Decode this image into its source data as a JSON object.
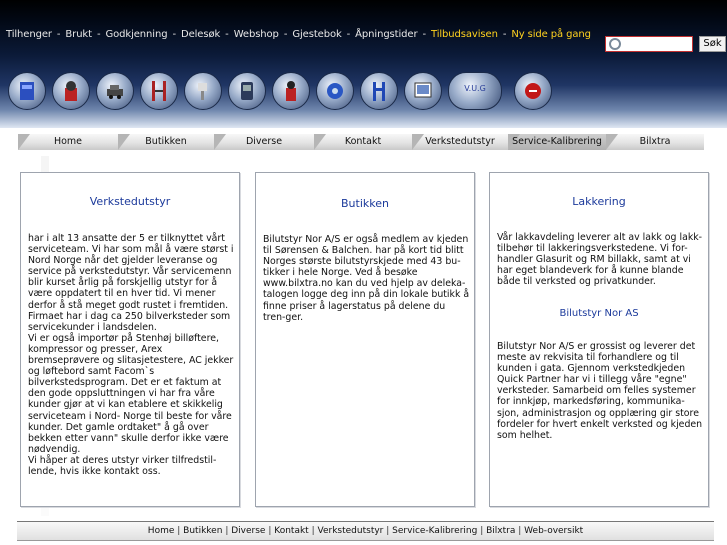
{
  "topnav": {
    "items": [
      "Tilhenger",
      "Brukt",
      "Godkjenning",
      "Delesøk",
      "Webshop",
      "Gjestebok",
      "Åpningstider",
      "Tilbudsavisen"
    ],
    "extra": "Ny side på gang"
  },
  "search": {
    "button_label": "Søk",
    "value": ""
  },
  "icons": [
    "lift-icon",
    "tire-changer-icon",
    "car-icon",
    "two-post-lift-icon",
    "spray-gun-icon",
    "compressor-icon",
    "balancer-icon",
    "hose-reel-icon",
    "jack-icon",
    "monitor-icon",
    "vug-logo-icon",
    "stop-icon"
  ],
  "icon_text": {
    "vug": "V.U.G"
  },
  "nav": [
    "Home",
    "Butikken",
    "Diverse",
    "Kontakt",
    "Verkstedutstyr",
    "Service-Kalibrering",
    "Bilxtra"
  ],
  "boxes": {
    "verksted": {
      "title": "Verkstedutstyr",
      "body": "har i alt 13 ansatte der 5 er tilknyttet vårt serviceteam.  Vi har som mål å være størst i Nord Norge når det gjelder leveranse og service på verkstedutstyr. Vår servicemenn blir kurset årlig på forskjellig utstyr for å være oppdatert til en hver tid. Vi mener derfor å stå meget godt rustet i fremtiden. Firmaet har i dag ca 250 bilverksteder som servicekunder i landsdelen.\nVi er også importør på Stenhøj billøftere, kompressor og presser, Arex bremseprøvere og slitasjetestere, AC jekker og løftebord samt Facom`s bilverkstedsprogram. Det er et faktum at den gode oppsluttningen vi har fra våre kunder gjør at vi kan etablere et skikkelig serviceteam i Nord- Norge til beste for våre kunder. Det gamle ordtaket\" å gå over bekken etter vann\" skulle derfor ikke være nødvendig.\nVi håper at deres utstyr virker tilfredstil-lende, hvis ikke kontakt oss."
    },
    "butikken": {
      "title": "Butikken",
      "body": "Bilutstyr Nor A/S er også medlem av kjeden til Sørensen & Balchen.  har på kort tid blitt Norges største bilutstyrskjede med 43 bu-tikker i hele Norge. Ved å besøke www.bilxtra.no kan du ved hjelp av deleka-talogen logge deg inn på din lokale butikk å finne priser å lagerstatus på delene du tren-ger."
    },
    "lakkering": {
      "title": "Lakkering",
      "body": "Vår lakkavdeling leverer alt av lakk og lakk-tilbehør til lakkeringsverkstedene. Vi for-handler Glasurit og RM billakk, samt at vi har eget blandeverk for å kunne blande både til verksted og privatkunder.",
      "subtitle": "Bilutstyr Nor AS",
      "body2": "Bilutstyr Nor A/S er grossist og leverer det meste av rekvisita til forhandlere og til kunden i gata. Gjennom verkstedkjeden Quick Partner har vi i tillegg våre \"egne\" verksteder. Samarbeid om felles systemer for innkjøp, markedsføring, kommunika-sjon, administrasjon og opplæring gir store fordeler for hvert enkelt verksted og kjeden som helhet."
    }
  },
  "footer": [
    "Home",
    "Butikken",
    "Diverse",
    "Kontakt",
    "Verkstedutstyr",
    "Service-Kalibrering",
    "Bilxtra",
    "Web-oversikt"
  ]
}
